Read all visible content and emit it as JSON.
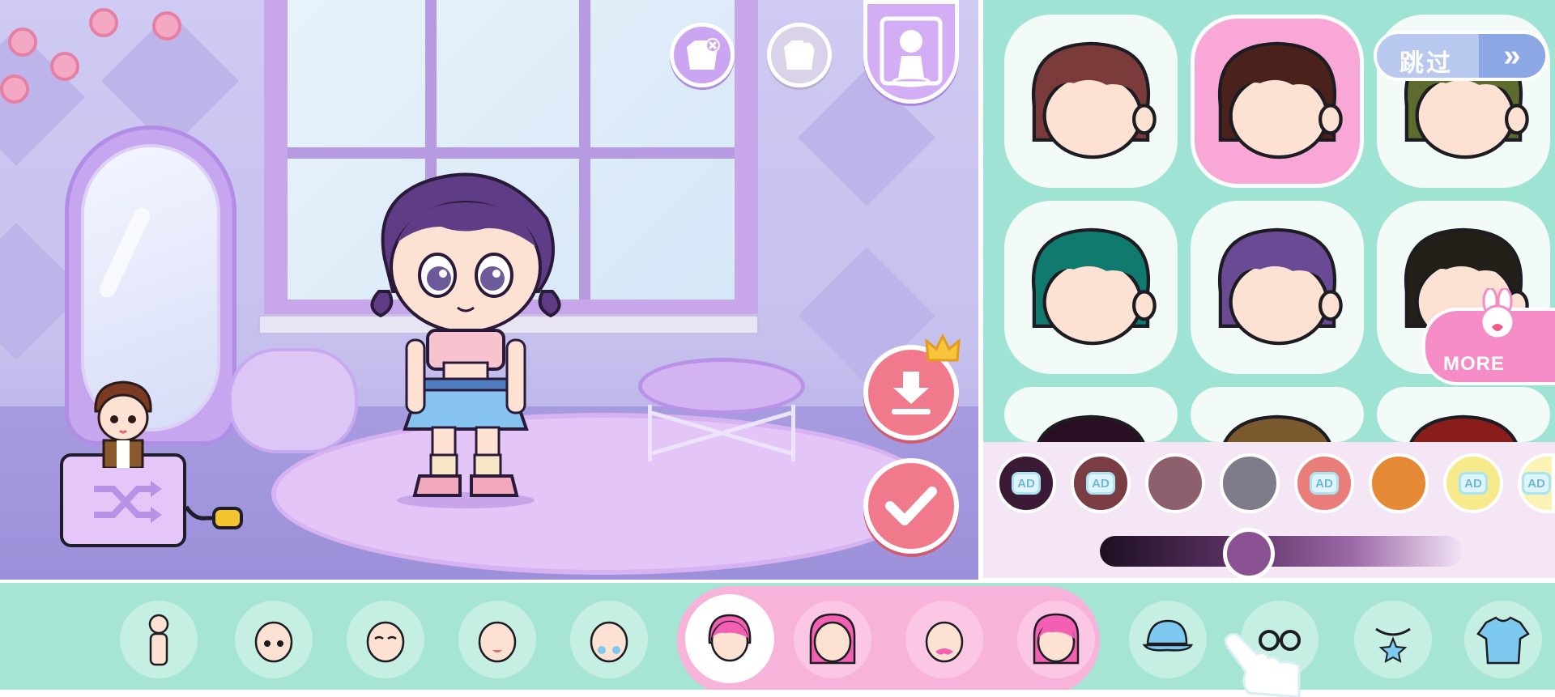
{
  "top_buttons": {
    "remove_icon": "remove-clothes-icon",
    "reset_icon": "undo-clothes-icon",
    "portrait_icon": "character-portrait-icon"
  },
  "actions": {
    "download_icon": "download-icon",
    "premium_icon": "crown-icon",
    "confirm_icon": "checkmark-icon"
  },
  "skip": {
    "label": "跳过",
    "arrow": "»"
  },
  "more": {
    "label": "MORE"
  },
  "hair_options": [
    {
      "color": "#7b3b3a",
      "selected": false
    },
    {
      "color": "#4a211b",
      "selected": true
    },
    {
      "color": "#5d6b2f",
      "selected": false
    },
    {
      "color": "#0f7a6d",
      "selected": false
    },
    {
      "color": "#6b4a95",
      "selected": false
    },
    {
      "color": "#222019",
      "selected": false
    },
    {
      "color": "#2a0f24",
      "selected": false
    },
    {
      "color": "#7a5a2c",
      "selected": false
    },
    {
      "color": "#8a1c1c",
      "selected": false
    }
  ],
  "colors": [
    {
      "hex": "#3a1a35",
      "ad": "AD"
    },
    {
      "hex": "#7a3d44",
      "ad": "AD"
    },
    {
      "hex": "#8e5f6c",
      "ad": ""
    },
    {
      "hex": "#7f7b8a",
      "ad": ""
    },
    {
      "hex": "#e97d7a",
      "ad": "AD"
    },
    {
      "hex": "#e58936",
      "ad": ""
    },
    {
      "hex": "#f7ea8c",
      "ad": "AD"
    },
    {
      "hex": "#fbf3b6",
      "ad": "AD"
    }
  ],
  "slider": {
    "value": 0.41
  },
  "categories": [
    {
      "name": "body"
    },
    {
      "name": "eyes"
    },
    {
      "name": "eyebrows"
    },
    {
      "name": "mouth"
    },
    {
      "name": "face-decor"
    },
    {
      "name": "hairstyle"
    },
    {
      "name": "back-hair"
    },
    {
      "name": "beard"
    },
    {
      "name": "full-hair"
    },
    {
      "name": "hat"
    },
    {
      "name": "glasses"
    },
    {
      "name": "necklace"
    },
    {
      "name": "top"
    }
  ]
}
